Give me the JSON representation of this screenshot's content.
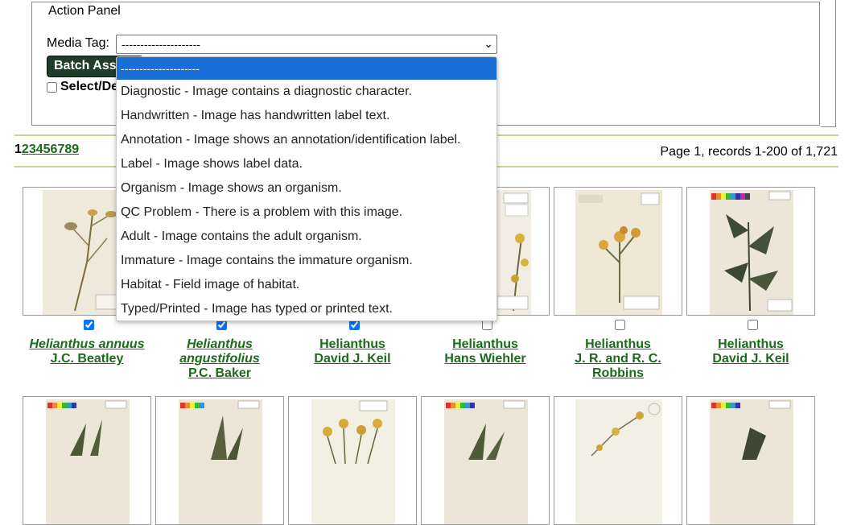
{
  "action_panel": {
    "legend": "Action Panel",
    "media_tag_label": "Media Tag:",
    "select_value": "---------------------",
    "batch_button": "Batch Ass",
    "select_all_label": "Select/De"
  },
  "dropdown_options": [
    "---------------------",
    "Diagnostic - Image contains a diagnostic character.",
    "Handwritten - Image has handwritten label text.",
    "Annotation - Image shows an annotation/identification label.",
    "Label - Image shows label data.",
    "Organism - Image shows an organism.",
    "QC Problem - There is a problem with this image.",
    "Adult - Image contains the adult organism.",
    "Immature - Image contains the immature organism.",
    "Habitat - Field image of habitat.",
    "Typed/Printed - Image has typed or printed text."
  ],
  "pagination": {
    "current": "1",
    "pages": [
      "2",
      "3",
      "4",
      "5",
      "6",
      "7",
      "8",
      "9"
    ],
    "info": "Page 1, records 1-200 of 1,721"
  },
  "records": [
    {
      "name": "Helianthus annuus",
      "collector": "J.C. Beatley",
      "italic": true,
      "checked": true
    },
    {
      "name": "Helianthus angustifolius",
      "collector": "P.C. Baker",
      "italic": true,
      "checked": true
    },
    {
      "name": "Helianthus",
      "collector": "David J. Keil",
      "italic": false,
      "checked": true
    },
    {
      "name": "Helianthus",
      "collector": "Hans Wiehler",
      "italic": false,
      "checked": false
    },
    {
      "name": "Helianthus",
      "collector": "J. R. and R. C. Robbins",
      "italic": false,
      "checked": false
    },
    {
      "name": "Helianthus",
      "collector": "David J. Keil",
      "italic": false,
      "checked": false
    }
  ],
  "colors": {
    "link_green": "#1a6b1a",
    "rule_green": "#c5d58a",
    "button_dark_green": "#1f3d2b",
    "selected_blue": "#1a6fd6"
  }
}
